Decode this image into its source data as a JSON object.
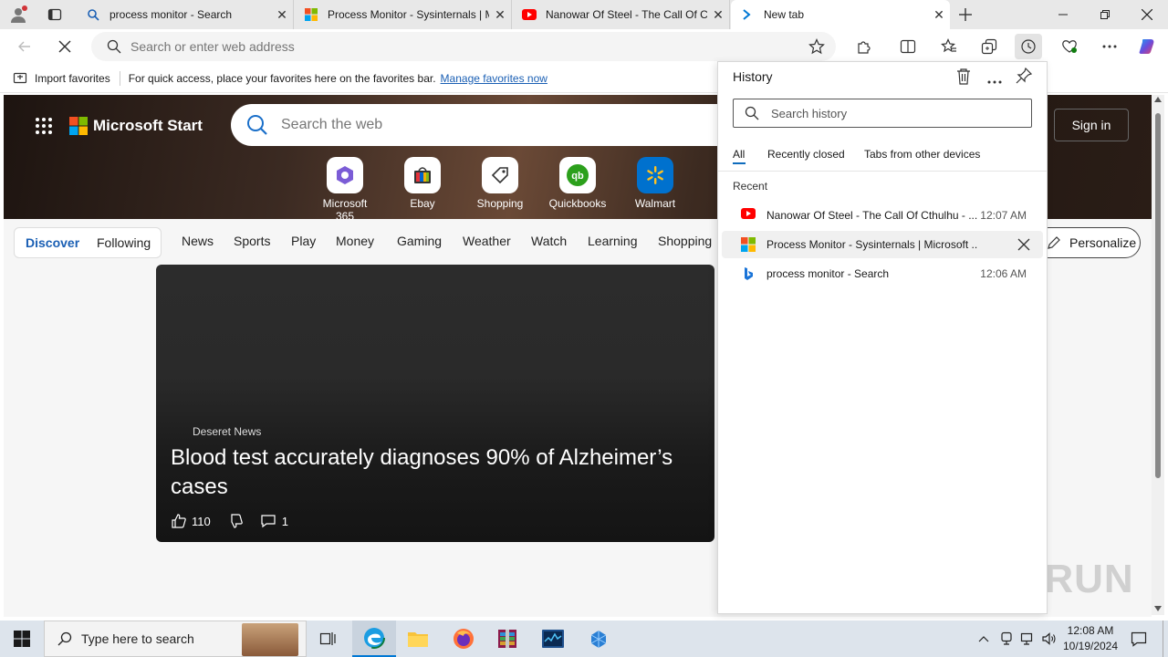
{
  "tabs": [
    {
      "title": "process monitor - Search",
      "icon": "search-icon"
    },
    {
      "title": "Process Monitor - Sysinternals | Microsoft Learn",
      "icon": "microsoft-logo-icon"
    },
    {
      "title": "Nanowar Of Steel - The Call Of Cthulhu",
      "icon": "youtube-icon"
    },
    {
      "title": "New tab",
      "icon": "edge-newtab-icon"
    }
  ],
  "address_bar": {
    "placeholder": "Search or enter web address"
  },
  "favorites_bar": {
    "import_label": "Import favorites",
    "hint": "For quick access, place your favorites here on the favorites bar.",
    "manage_link": "Manage favorites now"
  },
  "msn": {
    "brand": "Microsoft Start",
    "search_placeholder": "Search the web",
    "sign_in": "Sign in",
    "quick_links": [
      {
        "label": "Microsoft 365",
        "color": "#7b5cd6"
      },
      {
        "label": "Ebay",
        "color": "#e53238"
      },
      {
        "label": "Shopping",
        "color": "#333333"
      },
      {
        "label": "Quickbooks",
        "color": "#2ca01c"
      },
      {
        "label": "Walmart",
        "color": "#0071ce"
      }
    ],
    "nav": {
      "discover": "Discover",
      "following": "Following",
      "items": [
        "News",
        "Sports",
        "Play",
        "Money",
        "Gaming",
        "Weather",
        "Watch",
        "Learning",
        "Shopping"
      ],
      "personalize": "Personalize"
    },
    "card": {
      "source": "Deseret News",
      "headline": "Blood test accurately diagnoses 90% of Alzheimer’s cases",
      "likes": "110",
      "comments": "1"
    }
  },
  "history": {
    "title": "History",
    "search_placeholder": "Search history",
    "tabs": [
      "All",
      "Recently closed",
      "Tabs from other devices"
    ],
    "section": "Recent",
    "items": [
      {
        "title": "Nanowar Of Steel - The Call Of Cthulhu - ...",
        "time": "12:07 AM",
        "icon": "youtube-icon"
      },
      {
        "title": "Process Monitor - Sysinternals | Microsoft ...",
        "time": "",
        "icon": "microsoft-logo-icon"
      },
      {
        "title": "process monitor - Search",
        "time": "12:06 AM",
        "icon": "bing-icon"
      }
    ]
  },
  "taskbar": {
    "search_placeholder": "Type here to search",
    "time": "12:08 AM",
    "date": "10/19/2024"
  },
  "watermark": "ANY RUN"
}
